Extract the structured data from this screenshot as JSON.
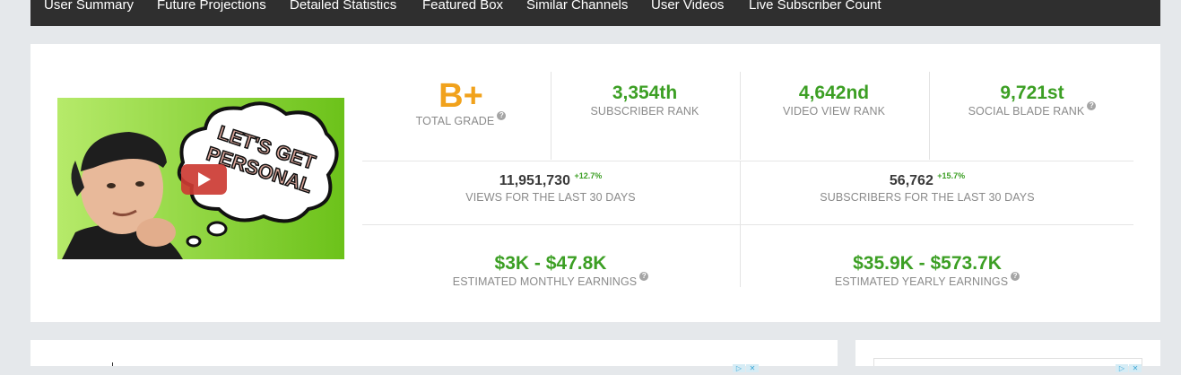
{
  "nav": {
    "items": [
      "User Summary",
      "Future Projections",
      "Detailed Statistics",
      "Featured Box",
      "Similar Channels",
      "User Videos",
      "Live Subscriber Count"
    ]
  },
  "thumbnail": {
    "caption_line1": "LET'S GET",
    "caption_line2": "PERSONAL"
  },
  "ranks": {
    "grade": {
      "value": "B+",
      "label": "TOTAL GRADE"
    },
    "subscriber": {
      "value": "3,354th",
      "label": "SUBSCRIBER RANK"
    },
    "video_view": {
      "value": "4,642nd",
      "label": "VIDEO VIEW RANK"
    },
    "socialblade": {
      "value": "9,721st",
      "label": "SOCIAL BLADE RANK"
    }
  },
  "thirty_days": {
    "views": {
      "value": "11,951,730",
      "change": "+12.7%",
      "label": "VIEWS FOR THE LAST 30 DAYS"
    },
    "subscribers": {
      "value": "56,762",
      "change": "+15.7%",
      "label": "SUBSCRIBERS FOR THE LAST 30 DAYS"
    }
  },
  "earnings": {
    "monthly": {
      "value": "$3K - $47.8K",
      "label": "ESTIMATED MONTHLY EARNINGS"
    },
    "yearly": {
      "value": "$35.9K - $573.7K",
      "label": "ESTIMATED YEARLY EARNINGS"
    }
  },
  "help_glyph": "?",
  "colors": {
    "nav_bg": "#2f2f2f",
    "accent_green": "#3c9f24",
    "grade_orange": "#f1a21c",
    "label_gray": "#8a8a8a"
  }
}
